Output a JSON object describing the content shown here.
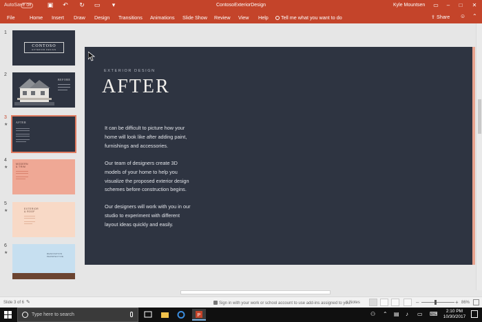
{
  "window": {
    "autosave_label": "AutoSave",
    "autosave_state": "Off",
    "doc_title": "ContosoExteriorDesign",
    "user_name": "Kyle Mountsen"
  },
  "ribbon": {
    "tabs": [
      "File",
      "Home",
      "Insert",
      "Draw",
      "Design",
      "Transitions",
      "Animations",
      "Slide Show",
      "Review",
      "View",
      "Help"
    ],
    "tell_me_placeholder": "Tell me what you want to do",
    "share_label": "Share"
  },
  "thumbnails": [
    {
      "number": "1",
      "big": "CONTOSO",
      "small": "EXTERIOR DESIGN"
    },
    {
      "number": "2",
      "label": "BEFORE"
    },
    {
      "number": "3",
      "label": "AFTER",
      "selected": true
    },
    {
      "number": "4",
      "label": "MODERN & TRIM"
    },
    {
      "number": "5",
      "label": "EXTERIOR & ROOF"
    },
    {
      "number": "6",
      "label": "RENOVATION PERSPECTIVE"
    }
  ],
  "slide": {
    "eyebrow": "EXTERIOR DESIGN",
    "title": "AFTER",
    "paragraphs": [
      [
        "It can be difficult to picture how your",
        "home will look like after adding paint,",
        "furnishings and accessories."
      ],
      [
        "Our team of designers create 3D",
        "models of your home to help you",
        "visualize the proposed exterior design",
        "schemes before construction begins."
      ],
      [
        "Our designers will work with you in our",
        "studio to experiment with different",
        "layout ideas quickly and easily."
      ]
    ]
  },
  "status": {
    "slide_count": "Slide 3 of 6",
    "signin_message": "Sign in with your work or school account to use add-ins assigned to you.",
    "notes_label": "Notes",
    "zoom": "86%"
  },
  "taskbar": {
    "search_placeholder": "Type here to search",
    "time": "2:10 PM",
    "date": "10/30/2017"
  },
  "colors": {
    "accent": "#c4442a",
    "slide_bg": "#2e3441"
  }
}
